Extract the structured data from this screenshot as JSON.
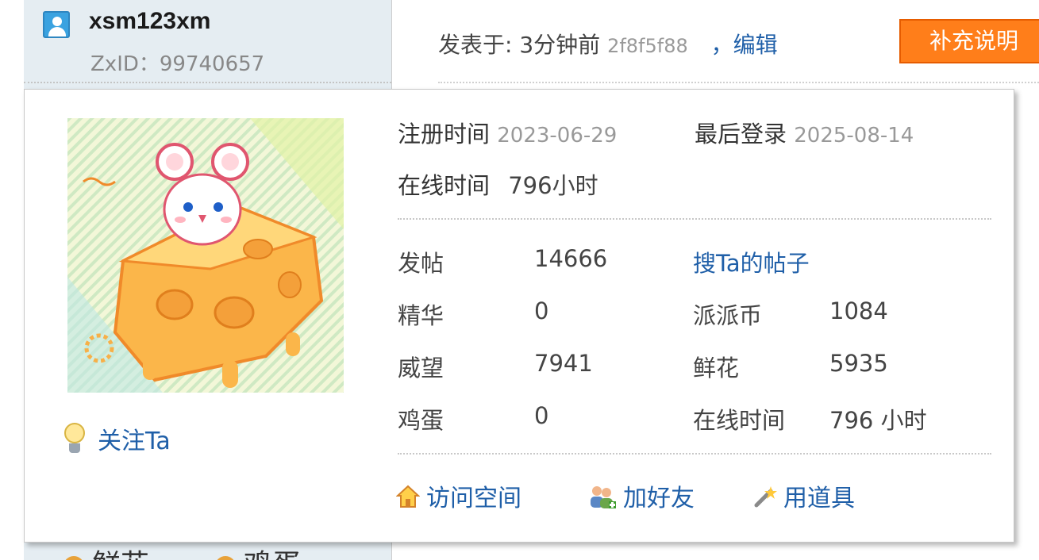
{
  "user": {
    "username": "xsm123xm",
    "zxid_label": "ZxID：99740657"
  },
  "post": {
    "posted_label": "发表于: 3分钟前",
    "hash": "2f8f5f88",
    "edit_link": "，编辑",
    "supplement_button": "补充说明"
  },
  "profile": {
    "register_label": "注册时间",
    "register_date": "2023-06-29",
    "last_login_label": "最后登录",
    "last_login_date": "2025-08-14",
    "online_label": "在线时间",
    "online_value": "796小时",
    "stats": [
      {
        "label": "发帖",
        "value": "14666"
      },
      {
        "label": "精华",
        "value": "0"
      },
      {
        "label": "威望",
        "value": "7941"
      },
      {
        "label": "鸡蛋",
        "value": "0"
      }
    ],
    "search_posts_link": "搜Ta的帖子",
    "stats_right": [
      {
        "label": "派派币",
        "value": "1084"
      },
      {
        "label": "鲜花",
        "value": "5935"
      },
      {
        "label": "在线时间",
        "value": "796 小时"
      }
    ],
    "follow_label": "关注Ta",
    "actions": [
      {
        "label": "访问空间",
        "icon": "home-icon"
      },
      {
        "label": "加好友",
        "icon": "add-friend-icon"
      },
      {
        "label": "用道具",
        "icon": "wand-icon"
      }
    ]
  },
  "background_fragments": {
    "left_bottom_1": "鲜花",
    "left_bottom_2": "鸡蛋"
  },
  "colors": {
    "link": "#1f5fa8",
    "accent_button": "#ff7e1a",
    "sidebar_bg": "#e5edf2"
  }
}
